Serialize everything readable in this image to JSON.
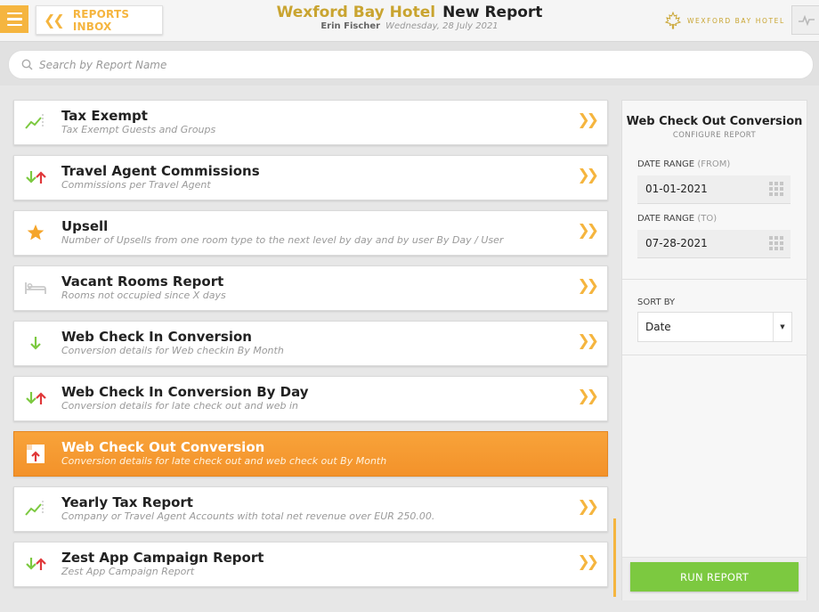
{
  "header": {
    "menu_icon": "hamburger-menu-icon",
    "back_label": "REPORTS INBOX",
    "hotel_name": "Wexford Bay Hotel",
    "page_title": "New Report",
    "user": "Erin Fischer",
    "date": "Wednesday, 28 July 2021",
    "brand_text": "WEXFORD BAY HOTEL",
    "brand_icon": "maple-leaf-icon",
    "pulse_icon": "activity-pulse-icon",
    "accent_color": "#f5b53f",
    "gold_color": "#c9a430"
  },
  "search": {
    "placeholder": "Search by Report Name",
    "icon": "search-icon"
  },
  "reports": [
    {
      "title": "Tax Exempt",
      "desc": "Tax Exempt Guests and Groups",
      "icon": "trend-chart-icon",
      "active": false
    },
    {
      "title": "Travel Agent Commissions",
      "desc": "Commissions per Travel Agent",
      "icon": "arrows-down-up-icon",
      "active": false
    },
    {
      "title": "Upsell",
      "desc": "Number of Upsells from one room type to the next level by day and by user By Day / User",
      "icon": "star-icon",
      "active": false
    },
    {
      "title": "Vacant Rooms Report",
      "desc": "Rooms not occupied since X days",
      "icon": "bed-icon",
      "active": false
    },
    {
      "title": "Web Check In Conversion",
      "desc": "Conversion details for Web checkin By Month",
      "icon": "arrow-down-icon",
      "active": false
    },
    {
      "title": "Web Check In Conversion By Day",
      "desc": "Conversion details for late check out and web in",
      "icon": "arrows-down-up-icon",
      "active": false
    },
    {
      "title": "Web Check Out Conversion",
      "desc": "Conversion details for late check out and web check out By Month",
      "icon": "checkout-door-icon",
      "active": true
    },
    {
      "title": "Yearly Tax Report",
      "desc": "Company or Travel Agent Accounts with total net revenue over EUR 250.00.",
      "icon": "trend-chart-icon",
      "active": false
    },
    {
      "title": "Zest App Campaign Report",
      "desc": "Zest App Campaign Report",
      "icon": "arrows-down-up-icon",
      "active": false
    }
  ],
  "panel": {
    "title": "Web Check Out Conversion",
    "subtitle": "CONFIGURE REPORT",
    "from_label": "DATE RANGE",
    "from_paren": "(FROM)",
    "from_value": "01-01-2021",
    "to_label": "DATE RANGE",
    "to_paren": "(TO)",
    "to_value": "07-28-2021",
    "sort_label": "SORT BY",
    "sort_value": "Date",
    "run_label": "RUN REPORT",
    "run_color": "#7cc940"
  }
}
